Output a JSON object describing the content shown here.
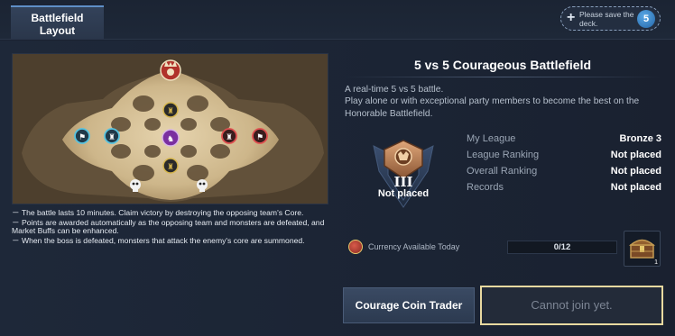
{
  "header": {
    "tab_label": "Battlefield Layout",
    "save_hint": "Please save the deck.",
    "save_count": "5"
  },
  "map": {
    "icons": [
      "boss-icon",
      "skull-icon",
      "monster-icon",
      "tower-icon",
      "core-icon"
    ]
  },
  "notes": [
    "－ The battle lasts 10 minutes. Claim victory by destroying the opposing team's Core.",
    "－ Points are awarded automatically as the opposing team and monsters are defeated, and Market Buffs can be enhanced.",
    "－ When the boss is defeated, monsters that attack the enemy's core are summoned."
  ],
  "panel": {
    "title": "5 vs 5 Courageous Battlefield",
    "description": "A real-time 5 vs 5 battle.\nPlay alone or with exceptional party members to become the best on the Honorable Battlefield.",
    "emblem_rank": "III",
    "emblem_label": "Not placed",
    "stats": [
      {
        "label": "My League",
        "value": "Bronze 3"
      },
      {
        "label": "League Ranking",
        "value": "Not placed"
      },
      {
        "label": "Overall Ranking",
        "value": "Not placed"
      },
      {
        "label": "Records",
        "value": "Not placed"
      }
    ],
    "currency_label": "Currency Available Today",
    "currency_value": "0/12",
    "chest_count": "1"
  },
  "buttons": {
    "trader": "Courage Coin Trader",
    "join": "Cannot join yet."
  },
  "colors": {
    "accent_blue": "#5f8fc7",
    "join_border": "#e8d9a0",
    "background": "#1a2231"
  }
}
